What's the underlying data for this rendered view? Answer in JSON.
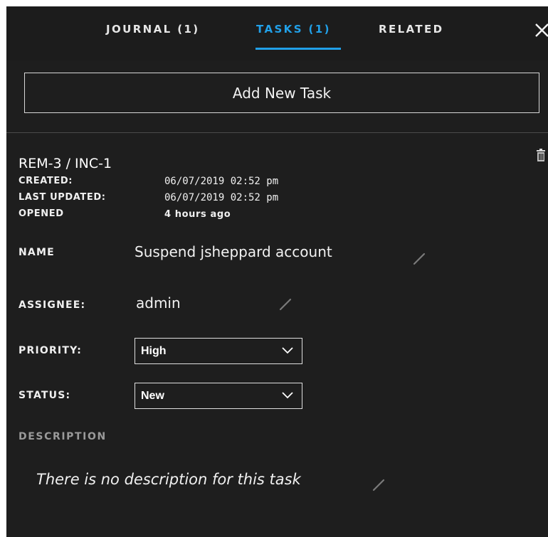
{
  "tabs": [
    {
      "label": "JOURNAL (1)",
      "active": false
    },
    {
      "label": "TASKS (1)",
      "active": true
    },
    {
      "label": "RELATED",
      "active": false
    }
  ],
  "actions": {
    "add_task_label": "Add New Task"
  },
  "task": {
    "id_label": "REM-3 / INC-1",
    "meta": [
      {
        "label": "CREATED:",
        "value": "06/07/2019 02:52 pm"
      },
      {
        "label": "LAST UPDATED:",
        "value": "06/07/2019 02:52 pm"
      },
      {
        "label": "OPENED",
        "value": "4 hours ago"
      }
    ],
    "name_label": "NAME",
    "name_value": "Suspend jsheppard account",
    "assignee_label": "ASSIGNEE:",
    "assignee_value": "admin",
    "priority_label": "PRIORITY:",
    "priority_value": "High",
    "status_label": "STATUS:",
    "status_value": "New",
    "description_label": "DESCRIPTION",
    "description_value": "There is no description for this task"
  },
  "colors": {
    "background": "#1e1e1e",
    "accent": "#21a0e8",
    "text": "#f0f0f0",
    "muted": "#9a9a9a"
  },
  "icons": {
    "close": "close-icon",
    "trash": "trash-icon",
    "edit": "pencil-icon",
    "dropdown": "chevron-down-icon"
  }
}
